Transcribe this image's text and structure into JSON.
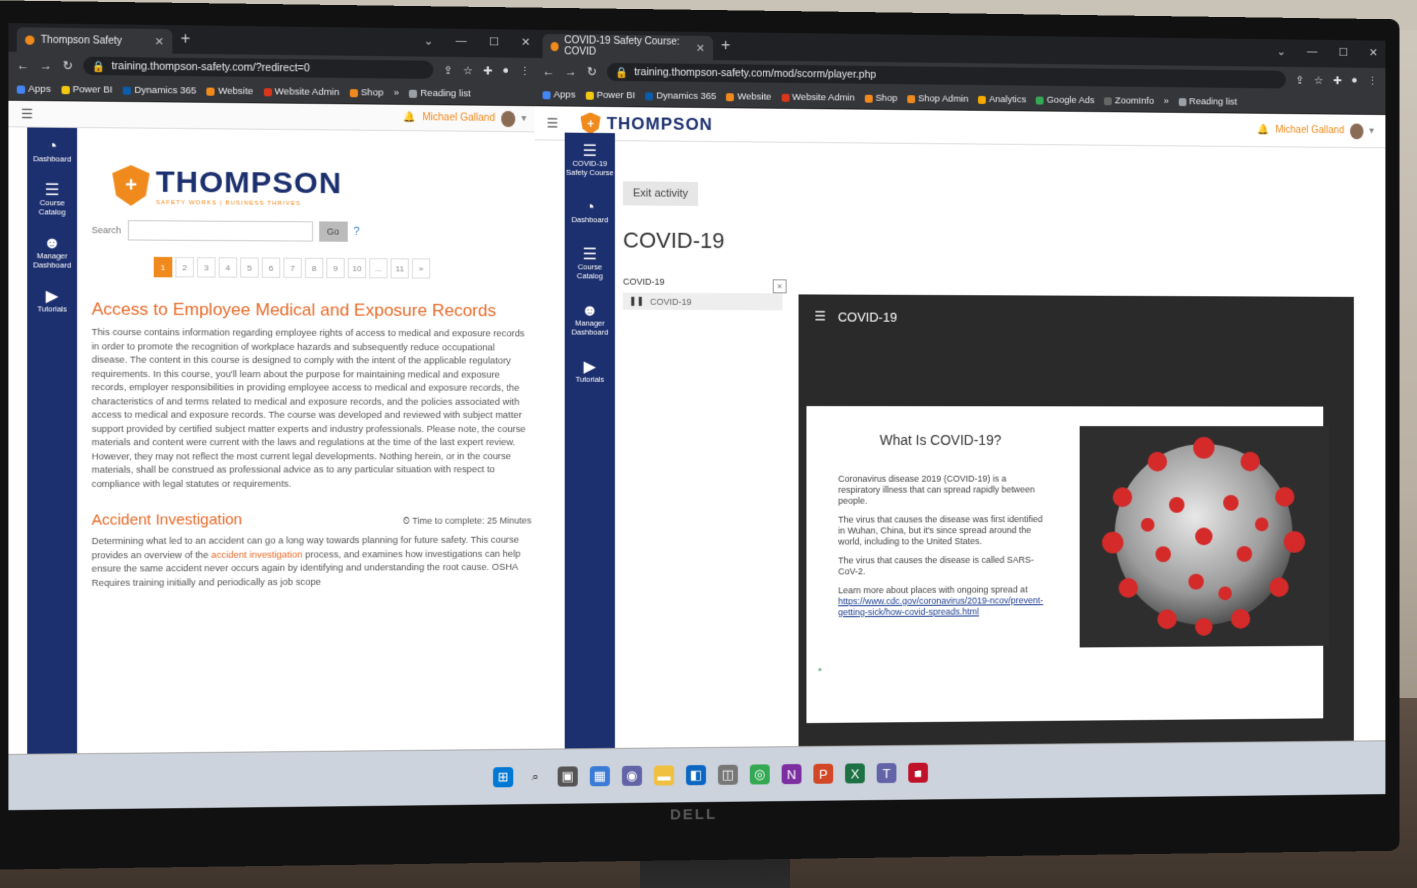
{
  "monitor_brand": "DELL",
  "left_window": {
    "tab_title": "Thompson Safety",
    "url": "training.thompson-safety.com/?redirect=0",
    "bookmarks": [
      "Apps",
      "Power BI",
      "Dynamics 365",
      "Website",
      "Website Admin",
      "Shop"
    ],
    "reading_list": "Reading list",
    "user_name": "Michael Galland",
    "sidebar": [
      {
        "label": "Dashboard",
        "icon": "dashboard-icon"
      },
      {
        "label": "Course Catalog",
        "icon": "list-icon"
      },
      {
        "label": "Manager Dashboard",
        "icon": "users-icon"
      },
      {
        "label": "Tutorials",
        "icon": "play-icon"
      }
    ],
    "logo": {
      "name": "THOMPSON",
      "tagline": "SAFETY WORKS | BUSINESS THRIVES"
    },
    "search_label": "Search",
    "go_label": "Go",
    "pages": [
      "1",
      "2",
      "3",
      "4",
      "5",
      "6",
      "7",
      "8",
      "9",
      "10",
      "...",
      "11",
      "»"
    ],
    "course1_title": "Access to Employee Medical and Exposure Records",
    "course1_body": "This course contains information regarding employee rights of access to medical and exposure records in order to promote the recognition of workplace hazards and subsequently reduce occupational disease. The content in this course is designed to comply with the intent of the applicable regulatory requirements. In this course, you'll learn about the purpose for maintaining medical and exposure records, employer responsibilities in providing employee access to medical and exposure records, the characteristics of and terms related to medical and exposure records, and the policies associated with access to medical and exposure records. The course was developed and reviewed with subject matter support provided by certified subject matter experts and industry professionals. Please note, the course materials and content were current with the laws and regulations at the time of the last expert review. However, they may not reflect the most current legal developments. Nothing herein, or in the course materials, shall be construed as professional advice as to any particular situation with respect to compliance with legal statutes or requirements.",
    "course2_title": "Accident Investigation",
    "course2_time": "Time to complete: 25 Minutes",
    "course2_body_a": "Determining what led to an accident can go a long way towards planning for future safety. This course provides an overview of the",
    "course2_link": "accident investigation",
    "course2_body_b": "process, and examines how investigations can help ensure the same accident never occurs again by identifying and understanding the root cause. OSHA Requires training initially and periodically as job scope"
  },
  "right_window": {
    "tab_title": "COVID-19 Safety Course: COVID",
    "url": "training.thompson-safety.com/mod/scorm/player.php",
    "bookmarks": [
      "Apps",
      "Power BI",
      "Dynamics 365",
      "Website",
      "Website Admin",
      "Shop",
      "Shop Admin",
      "Analytics",
      "Google Ads",
      "ZoomInfo"
    ],
    "reading_list": "Reading list",
    "logo_name": "THOMPSON",
    "user_name": "Michael Galland",
    "sidebar": [
      {
        "label": "COVID-19 Safety Course",
        "icon": "list-icon"
      },
      {
        "label": "Dashboard",
        "icon": "dashboard-icon"
      },
      {
        "label": "Course Catalog",
        "icon": "list-icon"
      },
      {
        "label": "Manager Dashboard",
        "icon": "users-icon"
      },
      {
        "label": "Tutorials",
        "icon": "play-icon"
      }
    ],
    "exit_label": "Exit activity",
    "page_title": "COVID-19",
    "toc_heading": "COVID-19",
    "toc_item": "COVID-19",
    "player_title": "COVID-19",
    "slide": {
      "title": "What Is COVID-19?",
      "p1": "Coronavirus disease 2019 (COVID-19) is a respiratory illness that can spread rapidly between people.",
      "p2": "The virus that causes the disease was first identified in Wuhan, China, but it's since spread around the world, including to the United States.",
      "p3": "The virus that causes the disease is called SARS-CoV-2.",
      "p4": "Learn more about places with ongoing spread at",
      "link": "https://www.cdc.gov/coronavirus/2019-ncov/prevent-getting-sick/how-covid-spreads.html"
    }
  },
  "colors": {
    "brand_orange": "#f08a1c",
    "brand_navy": "#1c2f6e"
  }
}
